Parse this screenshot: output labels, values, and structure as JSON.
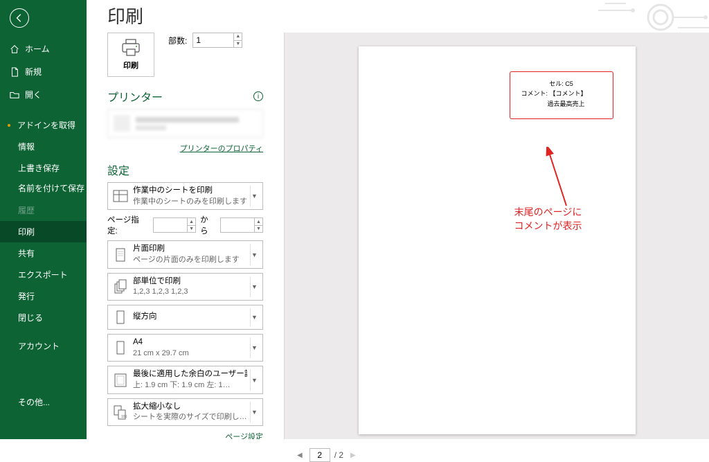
{
  "pageTitle": "印刷",
  "sidebar": {
    "home": "ホーム",
    "new": "新規",
    "open": "開く",
    "addin": "アドインを取得",
    "info": "情報",
    "save": "上書き保存",
    "saveas": "名前を付けて保存",
    "history": "履歴",
    "print": "印刷",
    "share": "共有",
    "export": "エクスポート",
    "publish": "発行",
    "close": "閉じる",
    "account": "アカウント",
    "other": "その他..."
  },
  "printBtn": "印刷",
  "copiesLabel": "部数:",
  "copiesValue": "1",
  "printerHeader": "プリンター",
  "printerPropsLink": "プリンターのプロパティ",
  "settingsHeader": "設定",
  "settings": {
    "sheets": {
      "title": "作業中のシートを印刷",
      "sub": "作業中のシートのみを印刷します"
    },
    "pageRangeLabel": "ページ指定:",
    "pageRangeFrom": "から",
    "simplex": {
      "title": "片面印刷",
      "sub": "ページの片面のみを印刷します"
    },
    "collate": {
      "title": "部単位で印刷",
      "sub": "1,2,3   1,2,3   1,2,3"
    },
    "orientation": {
      "title": "縦方向"
    },
    "paper": {
      "title": "A4",
      "sub": "21 cm x 29.7 cm"
    },
    "margins": {
      "title": "最後に適用した余白のユーザー設定",
      "sub": "上: 1.9 cm 下: 1.9 cm 左: 1…"
    },
    "scaling": {
      "title": "拡大縮小なし",
      "sub": "シートを実際のサイズで印刷します"
    }
  },
  "pageSetupLink": "ページ設定",
  "preview": {
    "commentCell": "セル: C5",
    "commentLabel": "コメント: 【コメント】",
    "commentBody": "過去最高売上",
    "annotationLine1": "末尾のページに",
    "annotationLine2": "コメントが表示",
    "currentPage": "2",
    "totalPages": "/ 2"
  }
}
